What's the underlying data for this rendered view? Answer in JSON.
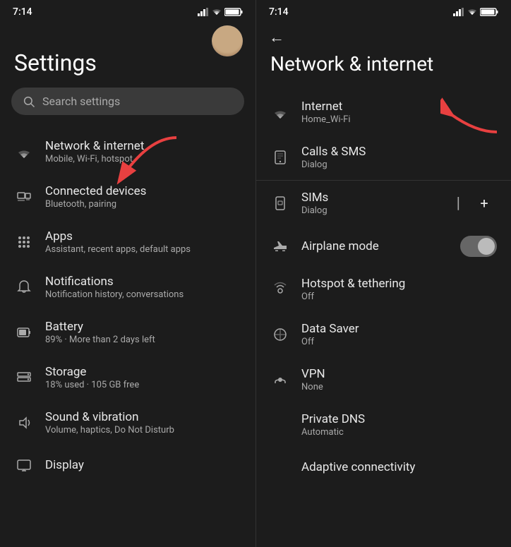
{
  "left": {
    "status_time": "7:14",
    "title": "Settings",
    "search_placeholder": "Search settings",
    "items": [
      {
        "id": "network",
        "title": "Network & internet",
        "subtitle": "Mobile, Wi-Fi, hotspot",
        "icon": "wifi"
      },
      {
        "id": "connected",
        "title": "Connected devices",
        "subtitle": "Bluetooth, pairing",
        "icon": "connected"
      },
      {
        "id": "apps",
        "title": "Apps",
        "subtitle": "Assistant, recent apps, default apps",
        "icon": "apps"
      },
      {
        "id": "notifications",
        "title": "Notifications",
        "subtitle": "Notification history, conversations",
        "icon": "bell"
      },
      {
        "id": "battery",
        "title": "Battery",
        "subtitle": "89% · More than 2 days left",
        "icon": "battery"
      },
      {
        "id": "storage",
        "title": "Storage",
        "subtitle": "18% used · 105 GB free",
        "icon": "storage"
      },
      {
        "id": "sound",
        "title": "Sound & vibration",
        "subtitle": "Volume, haptics, Do Not Disturb",
        "icon": "sound"
      },
      {
        "id": "display",
        "title": "Display",
        "subtitle": "",
        "icon": "display"
      }
    ]
  },
  "right": {
    "status_time": "7:14",
    "title": "Network & internet",
    "back_label": "←",
    "items": [
      {
        "id": "internet",
        "title": "Internet",
        "subtitle": "Home_Wi-Fi",
        "icon": "wifi",
        "has_arrow": true
      },
      {
        "id": "calls",
        "title": "Calls & SMS",
        "subtitle": "Dialog",
        "icon": "calls",
        "has_divider": true
      },
      {
        "id": "sims",
        "title": "SIMs",
        "subtitle": "Dialog",
        "icon": "sims",
        "has_plus": true
      },
      {
        "id": "airplane",
        "title": "Airplane mode",
        "subtitle": "",
        "icon": "airplane",
        "has_toggle": true
      },
      {
        "id": "hotspot",
        "title": "Hotspot & tethering",
        "subtitle": "Off",
        "icon": "hotspot"
      },
      {
        "id": "datasaver",
        "title": "Data Saver",
        "subtitle": "Off",
        "icon": "datasaver"
      },
      {
        "id": "vpn",
        "title": "VPN",
        "subtitle": "None",
        "icon": "vpn"
      },
      {
        "id": "privatedns",
        "title": "Private DNS",
        "subtitle": "Automatic",
        "icon": "privatedns"
      },
      {
        "id": "adaptive",
        "title": "Adaptive connectivity",
        "subtitle": "",
        "icon": "adaptive"
      }
    ]
  }
}
